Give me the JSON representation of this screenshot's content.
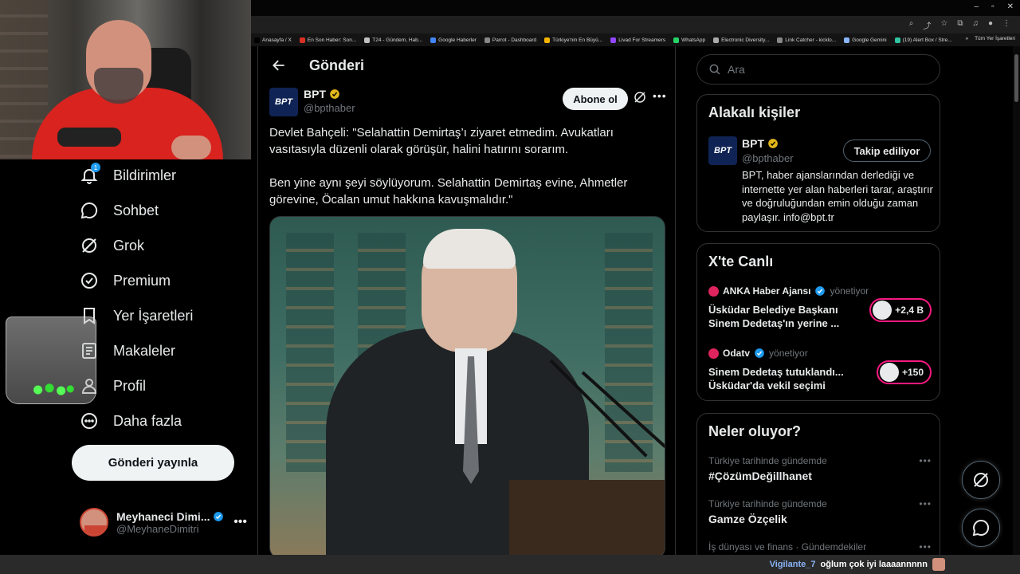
{
  "browser": {
    "bookmarks": [
      {
        "label": "Anasayfa / X",
        "color": "#000000"
      },
      {
        "label": "En Son Haber: Son...",
        "color": "#d93025"
      },
      {
        "label": "T24 - Gündem, Hab...",
        "color": "#c0c0c0"
      },
      {
        "label": "Google Haberler",
        "color": "#4285f4"
      },
      {
        "label": "Parrot - Dashboard",
        "color": "#888888"
      },
      {
        "label": "Türkiye'nin En Büyü...",
        "color": "#f4b400"
      },
      {
        "label": "Livad For Streamers",
        "color": "#9146ff"
      },
      {
        "label": "WhatsApp",
        "color": "#25d366"
      },
      {
        "label": "Electronic Diversity...",
        "color": "#aaaaaa"
      },
      {
        "label": "Link Catcher - kicklo...",
        "color": "#888888"
      },
      {
        "label": "Google Gemini",
        "color": "#8ab4f8"
      },
      {
        "label": "(19) Alert Box / Stre...",
        "color": "#31c3a2"
      }
    ],
    "all_bookmarks": "Tüm Yer İşaretleri",
    "overflow": "»"
  },
  "nav": {
    "notifications": {
      "label": "Bildirimler",
      "badge": "1"
    },
    "messages": "Sohbet",
    "grok": "Grok",
    "premium": "Premium",
    "bookmarks": "Yer İşaretleri",
    "articles": "Makaleler",
    "profile": "Profil",
    "more": "Daha fazla",
    "post_button": "Gönderi yayınla",
    "account": {
      "name": "Meyhaneci Dimi...",
      "handle": "@MeyhaneDimitri",
      "more": "•••"
    }
  },
  "post": {
    "header_title": "Gönderi",
    "author": {
      "name": "BPT",
      "handle": "@bpthaber",
      "avatar_text": "BPT"
    },
    "follow_label": "Abone ol",
    "more": "•••",
    "text_1": "Devlet Bahçeli: \"Selahattin Demirtaş’ı ziyaret etmedim. Avukatları vasıtasıyla düzenli olarak görüşür, halini hatırını sorarım.",
    "text_2": "Ben yine aynı şeyi söylüyorum. Selahattin Demirtaş evine, Ahmetler görevine, Öcalan umut hakkına kavuşmalıdır.\""
  },
  "sidebar": {
    "search_placeholder": "Ara",
    "related": {
      "title": "Alakalı kişiler",
      "name": "BPT",
      "handle": "@bpthaber",
      "avatar_text": "BPT",
      "button": "Takip ediliyor",
      "bio": "BPT, haber ajanslarından derlediği ve internette yer alan haberleri tarar, araştırır ve doğruluğundan emin olduğu zaman paylaşır. info@bpt.tr"
    },
    "live": {
      "title": "X'te Canlı",
      "items": [
        {
          "host": "ANKA Haber Ajansı",
          "status": "yönetiyor",
          "text": "Üsküdar Belediye Başkanı Sinem Dedetaş'ın yerine ...",
          "count": "+2,4 B",
          "logo_color": "#e0245e"
        },
        {
          "host": "Odatv",
          "status": "yönetiyor",
          "text": "Sinem Dedetaş tutuklandı... Üsküdar'da vekil seçimi",
          "count": "+150",
          "logo_color": "#e0245e"
        }
      ]
    },
    "trends": {
      "title": "Neler oluyor?",
      "items": [
        {
          "category": "Türkiye tarihinde gündemde",
          "title": "#ÇözümDeğillhanet"
        },
        {
          "category": "Türkiye tarihinde gündemde",
          "title": "Gamze Özçelik"
        },
        {
          "category": "İş dünyası ve finans · Gündemdekiler",
          "title": ""
        }
      ],
      "more": "•••"
    }
  },
  "chat": {
    "user": "Vigilante_7",
    "message": "oğlum çok iyi laaaannnnn"
  },
  "colors": {
    "accent": "#1d9bf0",
    "verified_gold": "#e2b719",
    "live_pink": "#f91880"
  }
}
